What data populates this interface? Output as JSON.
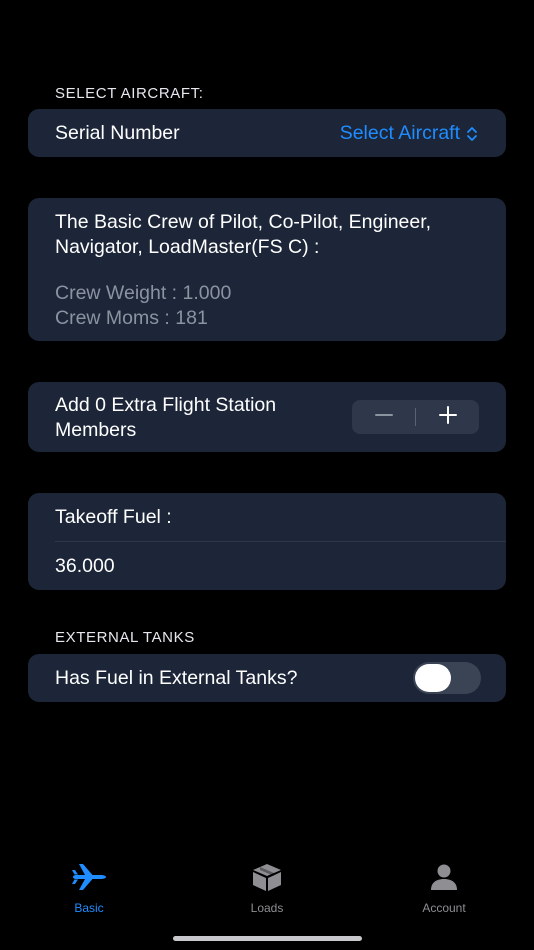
{
  "aircraft_section": {
    "header": "SELECT AIRCRAFT:",
    "serial_label": "Serial Number",
    "picker_label": "Select Aircraft"
  },
  "crew_card": {
    "description": "The Basic Crew of Pilot, Co-Pilot, Engineer, Navigator, LoadMaster(FS C) :",
    "weight": "Crew Weight : 1.000",
    "moms": "Crew Moms : 181"
  },
  "extra_crew": {
    "label": "Add 0 Extra Flight Station Members",
    "count": 0
  },
  "fuel_card": {
    "label": "Takeoff Fuel :",
    "value": "36.000"
  },
  "external_tanks": {
    "header": "EXTERNAL TANKS",
    "label": "Has Fuel in External Tanks?",
    "enabled": false
  },
  "tab_bar": {
    "tabs": [
      {
        "label": "Basic",
        "icon": "airplane-icon",
        "active": true
      },
      {
        "label": "Loads",
        "icon": "box-icon",
        "active": false
      },
      {
        "label": "Account",
        "icon": "person-icon",
        "active": false
      }
    ]
  },
  "colors": {
    "accent": "#1f8cff",
    "card": "#1c2638",
    "background": "#000000",
    "inactive": "#8e8e93"
  }
}
